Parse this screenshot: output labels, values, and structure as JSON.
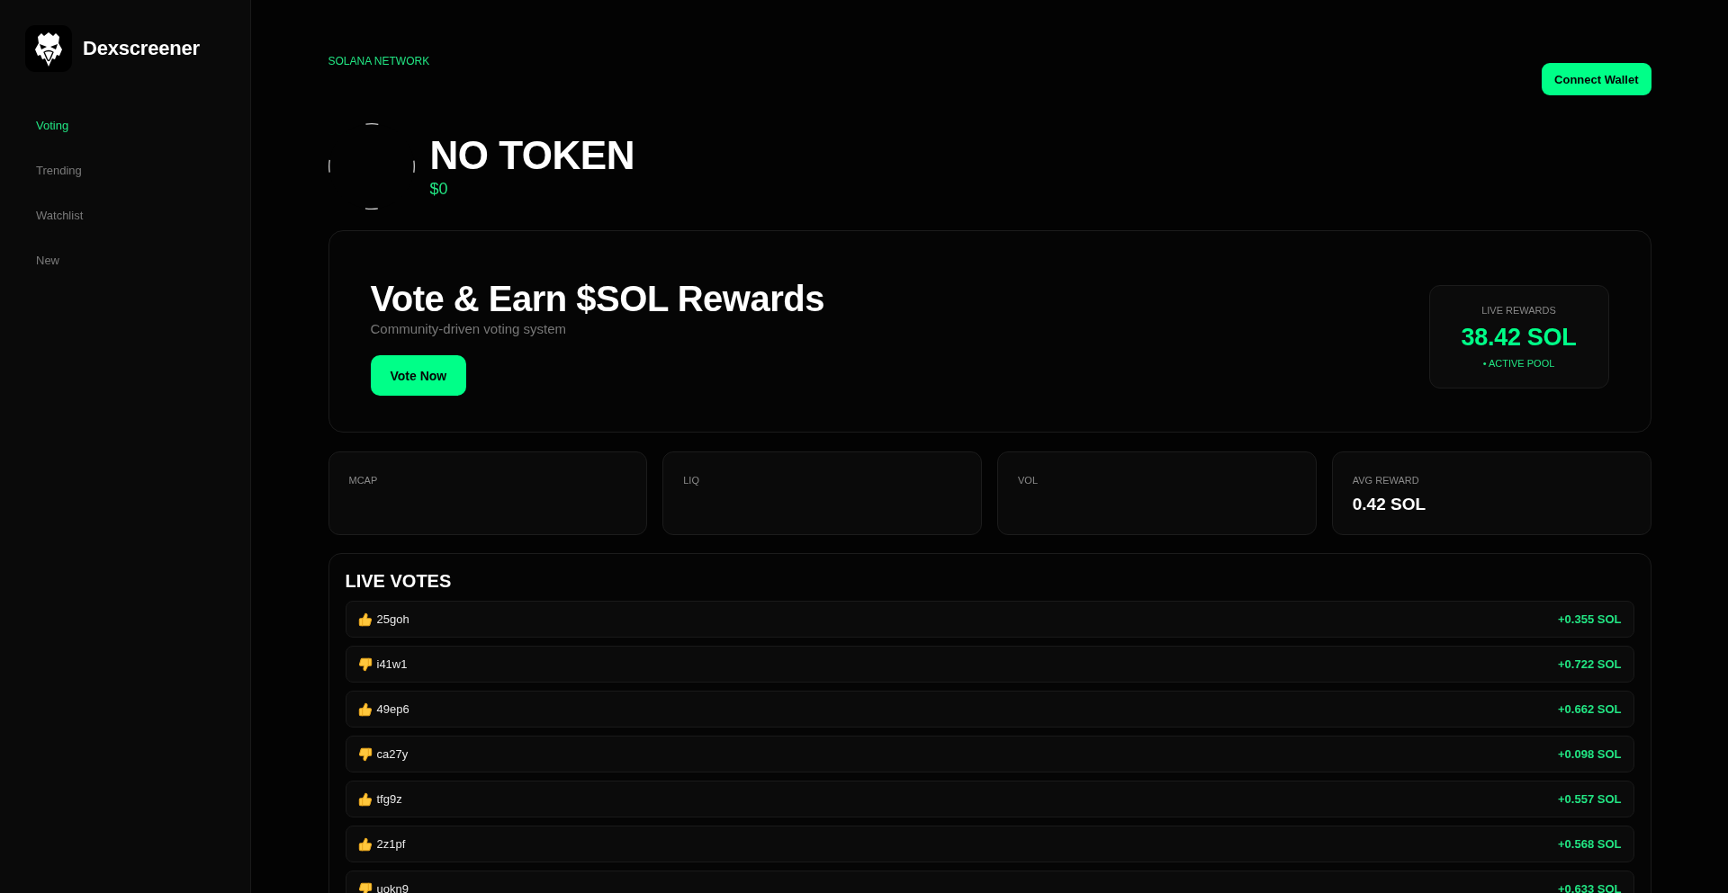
{
  "sidebar": {
    "brand": "Dexscreener",
    "nav": [
      {
        "label": "Voting",
        "selected": true
      },
      {
        "label": "Trending",
        "selected": false
      },
      {
        "label": "Watchlist",
        "selected": false
      },
      {
        "label": "New",
        "selected": false
      }
    ]
  },
  "header": {
    "network": "SOLANA NETWORK",
    "connect_button": "Connect Wallet"
  },
  "token": {
    "name": "NO TOKEN",
    "price": "$0"
  },
  "banner": {
    "title": "Vote & Earn $SOL Rewards",
    "subtitle": "Community-driven voting system",
    "button": "Vote Now",
    "rewards": {
      "label": "LIVE REWARDS",
      "value": "38.42 SOL",
      "status": "• ACTIVE POOL"
    }
  },
  "stats": [
    {
      "label": "MCAP"
    },
    {
      "label": "LIQ"
    },
    {
      "label": "VOL"
    },
    {
      "label": "AVG REWARD",
      "value": "0.42 SOL"
    }
  ],
  "live_votes": {
    "title": "LIVE VOTES",
    "rows": [
      {
        "kind": "up",
        "user": "25goh",
        "reward": "+0.355 SOL"
      },
      {
        "kind": "down",
        "user": "i41w1",
        "reward": "+0.722 SOL"
      },
      {
        "kind": "up",
        "user": "49ep6",
        "reward": "+0.662 SOL"
      },
      {
        "kind": "down",
        "user": "ca27y",
        "reward": "+0.098 SOL"
      },
      {
        "kind": "up",
        "user": "tfg9z",
        "reward": "+0.557 SOL"
      },
      {
        "kind": "up",
        "user": "2z1pf",
        "reward": "+0.568 SOL"
      },
      {
        "kind": "down",
        "user": "uokn9",
        "reward": "+0.633 SOL"
      }
    ]
  }
}
